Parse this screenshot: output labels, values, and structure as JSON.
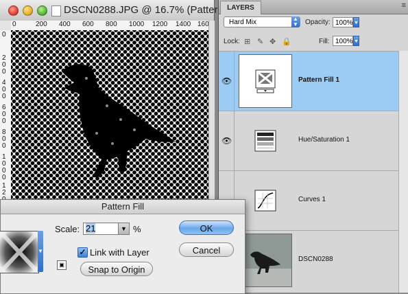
{
  "document": {
    "title": "DSCN0288.JPG @ 16.7% (Patter…",
    "ruler_h": [
      "0",
      "200",
      "400",
      "600",
      "800",
      "1000",
      "1200",
      "1400",
      "160"
    ],
    "ruler_v": [
      "0",
      "200",
      "400",
      "600",
      "800",
      "1000",
      "1200"
    ]
  },
  "layers_panel": {
    "tab": "LAYERS",
    "blend_mode": "Hard Mix",
    "opacity_label": "Opacity:",
    "opacity": "100%",
    "lock_label": "Lock:",
    "fill_label": "Fill:",
    "fill": "100%",
    "layers": [
      {
        "name": "Pattern Fill 1",
        "visible": true,
        "selected": true,
        "icon": "pattern-fill-icon"
      },
      {
        "name": "Hue/Saturation 1",
        "visible": true,
        "selected": false,
        "icon": "hue-saturation-icon"
      },
      {
        "name": "Curves 1",
        "visible": false,
        "selected": false,
        "icon": "curves-icon"
      },
      {
        "name": "DSCN0288",
        "visible": false,
        "selected": false,
        "icon": "photo-thumbnail"
      }
    ]
  },
  "dialog": {
    "title": "Pattern Fill",
    "scale_label": "Scale:",
    "scale_value": "21",
    "scale_unit": "%",
    "link_label": "Link with Layer",
    "link_checked": true,
    "snap_label": "Snap to Origin",
    "ok_label": "OK",
    "cancel_label": "Cancel"
  },
  "colors": {
    "selection": "#9ccbf3",
    "accent": "#3c82d9"
  }
}
